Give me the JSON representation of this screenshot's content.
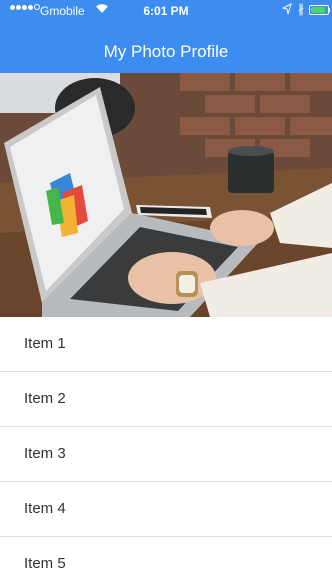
{
  "status_bar": {
    "carrier": "Gmobile",
    "time": "6:01 PM",
    "signal_bars": 4,
    "signal_total": 5,
    "battery_level": 0.9
  },
  "header": {
    "title": "My Photo Profile",
    "background_color": "#3d8cf0"
  },
  "photo": {
    "description_icon": "laptop-desk-photo"
  },
  "list": {
    "items": [
      {
        "label": "Item 1"
      },
      {
        "label": "Item 2"
      },
      {
        "label": "Item 3"
      },
      {
        "label": "Item 4"
      },
      {
        "label": "Item 5"
      }
    ]
  }
}
